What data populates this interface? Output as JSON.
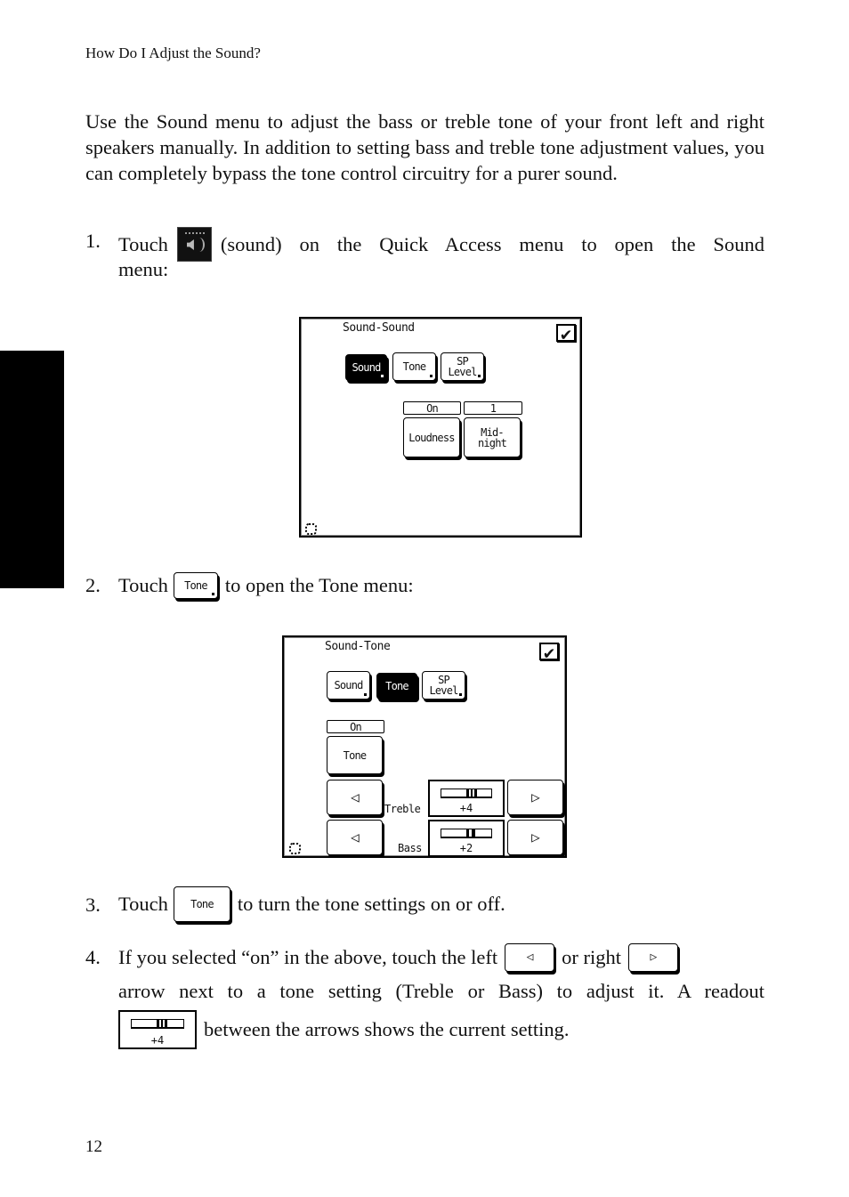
{
  "running_head": "How Do I Adjust the Sound?",
  "intro": "Use the Sound menu to adjust the bass or treble tone of your front left and right speakers manually. In addition to setting bass and treble tone adjustment values, you can completely bypass the tone control circuitry for a purer sound.",
  "steps": [
    {
      "num": "1.",
      "pre": "Touch",
      "icon": "sound-icon",
      "post_line1": "(sound) on the Quick Access menu to open the Sound",
      "post_line2": "menu:"
    },
    {
      "num": "2.",
      "pre": "Touch",
      "button_label": "Tone",
      "post": "to open the Tone menu:"
    },
    {
      "num": "3.",
      "pre": "Touch",
      "button_label": "Tone",
      "post": "to turn the tone settings on or off."
    },
    {
      "num": "4.",
      "line1_a": "If you selected “on” in the above, touch the left",
      "left_arrow": "◁",
      "line1_b": "or right",
      "right_arrow": "▷",
      "line2": "arrow next to a tone setting (Treble or Bass) to adjust it. A readout",
      "readout_value": "+4",
      "line3": "between the arrows shows the current setting."
    }
  ],
  "screen1": {
    "title": "Sound-Sound",
    "tabs": [
      {
        "label": "Sound",
        "active": true
      },
      {
        "label": "Tone",
        "active": false
      },
      {
        "label_line1": "SP",
        "label_line2": "Level",
        "active": false
      }
    ],
    "controls": [
      {
        "status": "On",
        "label": "Loudness"
      },
      {
        "status": "1",
        "label_line1": "Mid-",
        "label_line2": "night"
      }
    ],
    "check_icon": "✔"
  },
  "screen2": {
    "title": "Sound-Tone",
    "tabs": [
      {
        "label": "Sound",
        "active": false
      },
      {
        "label": "Tone",
        "active": true
      },
      {
        "label_line1": "SP",
        "label_line2": "Level",
        "active": false
      }
    ],
    "tone_status": "On",
    "tone_button": "Tone",
    "treble": {
      "label": "Treble",
      "value": "+4",
      "left": "◁",
      "right": "▷"
    },
    "bass": {
      "label": "Bass",
      "value": "+2",
      "left": "◁",
      "right": "▷"
    },
    "check_icon": "✔"
  },
  "page_number": "12"
}
